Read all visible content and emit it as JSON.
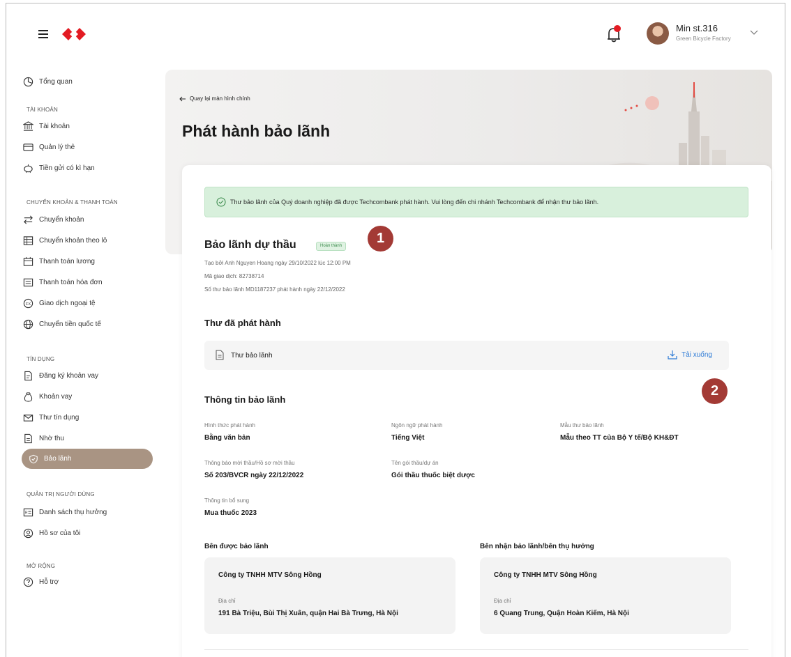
{
  "header": {
    "user_name": "Min st.316",
    "company": "Green Bicycle Factory",
    "notification_icon": "bell-icon",
    "brand_color": "#e31b23"
  },
  "sidebar": {
    "overview": "Tổng quan",
    "sections": {
      "account": "TÀI KHOẢN",
      "transfer": "CHUYỂN KHOẢN & THANH TOÁN",
      "credit": "TÍN DỤNG",
      "user_admin": "QUẢN TRỊ NGƯỜI DÙNG",
      "extend": "MỞ RỘNG"
    },
    "items": {
      "account": "Tài khoản",
      "cards": "Quản lý thẻ",
      "term_deposit": "Tiền gửi có kì hạn",
      "transfer": "Chuyển khoản",
      "batch_transfer": "Chuyển khoản theo lô",
      "payroll": "Thanh toán lương",
      "bill_payment": "Thanh toán hóa đơn",
      "fx": "Giao dịch ngoại tệ",
      "international": "Chuyển tiền quốc tế",
      "loan_register": "Đăng ký khoản vay",
      "loans": "Khoản vay",
      "letter_of_credit": "Thư tín dụng",
      "collection": "Nhờ thu",
      "guarantee": "Bảo lãnh",
      "beneficiaries": "Danh sách thụ hưởng",
      "my_profile": "Hồ sơ của tôi",
      "support": "Hỗ trợ"
    },
    "active_color": "#a99483"
  },
  "hero": {
    "back_link": "Quay lại màn hình chính",
    "title": "Phát hành bảo lãnh"
  },
  "detail": {
    "alert": "Thư bảo lãnh của Quý doanh nghiệp đã được Techcombank phát hành. Vui lòng đến chi nhánh Techcombank để nhận thư bảo lãnh.",
    "title": "Bảo lãnh dự thầu",
    "status": "Hoàn thành",
    "created_by": "Tạo bởi Anh Nguyen Hoang ngày 29/10/2022 lúc 12:00 PM",
    "transaction_id": "Mã giao dịch: 82738714",
    "letter_number": "Số thư bảo lãnh MD1187237 phát hành ngày 22/12/2022",
    "annotation_1": "1",
    "annotation_2": "2",
    "annotation_color": "#a33a35"
  },
  "issued": {
    "section_title": "Thư đã phát hành",
    "doc_name": "Thư bảo lãnh",
    "download_label": "Tải xuống"
  },
  "info": {
    "section_title": "Thông tin bảo lãnh",
    "fields": [
      {
        "label": "Hình thức phát hành",
        "value": "Bằng văn bản"
      },
      {
        "label": "Ngôn ngữ phát hành",
        "value": "Tiếng Việt"
      },
      {
        "label": "Mẫu thư bảo lãnh",
        "value": "Mẫu theo TT của Bộ Y tế/Bộ KH&ĐT"
      },
      {
        "label": "Thông báo mời thầu/Hồ sơ mời thầu",
        "value": "Số 203/BVCR ngày 22/12/2022"
      },
      {
        "label": "Tên gói thầu/dự án",
        "value": "Gói thầu thuốc biệt dược"
      },
      {
        "label": "Thông tin bổ sung",
        "value": "Mua thuốc 2023"
      }
    ]
  },
  "parties": {
    "guaranteed": {
      "heading": "Bên được bảo lãnh",
      "name": "Công ty TNHH MTV Sông Hồng",
      "address_label": "Địa chỉ",
      "address": "191 Bà Triệu, Bùi Thị Xuân, quận Hai Bà Trưng, Hà Nội"
    },
    "beneficiary": {
      "heading": "Bên nhận bảo lãnh/bên thụ hưởng",
      "name": "Công ty TNHH MTV Sông Hồng",
      "address_label": "Địa chỉ",
      "address": "6 Quang Trung, Quận Hoàn Kiếm, Hà Nội"
    }
  }
}
